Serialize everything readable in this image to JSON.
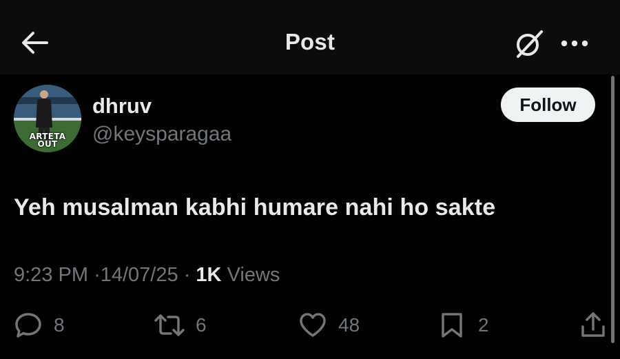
{
  "header": {
    "title": "Post",
    "back_icon": "arrow-left-icon",
    "grok_icon": "grok-icon",
    "more_icon": "more-dots-icon"
  },
  "author": {
    "display_name": "dhruv",
    "handle": "@keysparagaa",
    "avatar_text": "ARTETA\nOUT",
    "follow_label": "Follow"
  },
  "tweet": {
    "text": "Yeh musalman kabhi humare nahi ho sakte",
    "time": "9:23 PM",
    "separator": "·",
    "date": "14/07/25",
    "views_count": "1K",
    "views_label": "Views"
  },
  "actions": {
    "replies": "8",
    "reposts": "6",
    "likes": "48",
    "bookmarks": "2"
  },
  "colors": {
    "background": "#000000",
    "header_background": "#0c0c0c",
    "primary_text": "#e7e9ea",
    "secondary_text": "#71767b",
    "follow_button": "#eff3f4"
  }
}
